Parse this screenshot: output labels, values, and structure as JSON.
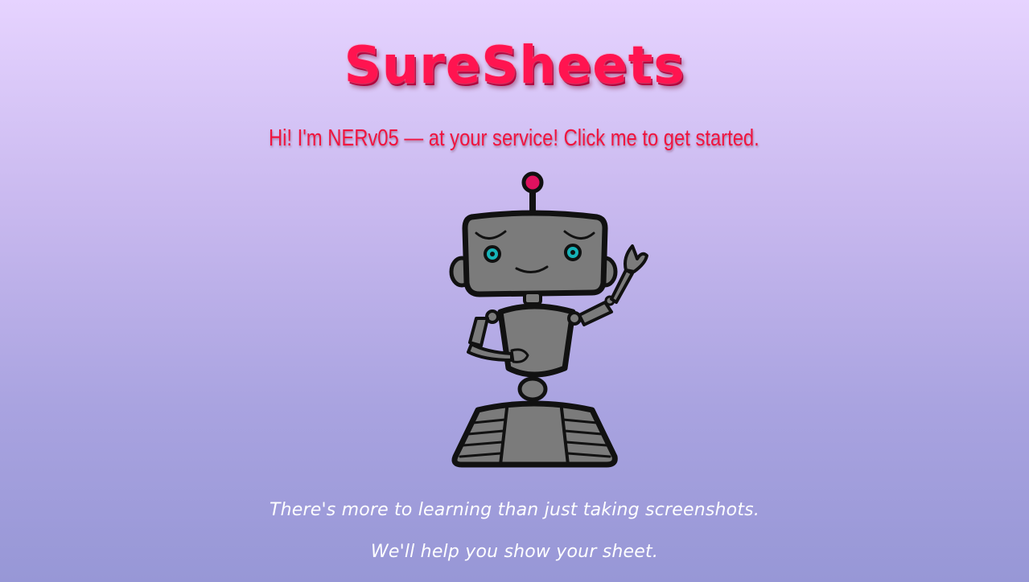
{
  "app": {
    "logo_text": "SureSheets"
  },
  "intro": {
    "greeting": "Hi! I'm NERv05 — at your service! Click me to get started."
  },
  "mascot": {
    "icon": "robot-mascot-icon",
    "colors": {
      "body": "#7b7b7b",
      "outline": "#111111",
      "eyes": "#16b3b8",
      "antenna_tip": "#e0115f"
    }
  },
  "taglines": {
    "line1": "There's more to learning than just taking screenshots.",
    "line2": "We'll help you show your sheet."
  },
  "theme": {
    "accent": "#ff1450",
    "background_top": "#e6d3ff",
    "background_bottom": "#9797d6",
    "tagline_color": "#ffffff"
  }
}
